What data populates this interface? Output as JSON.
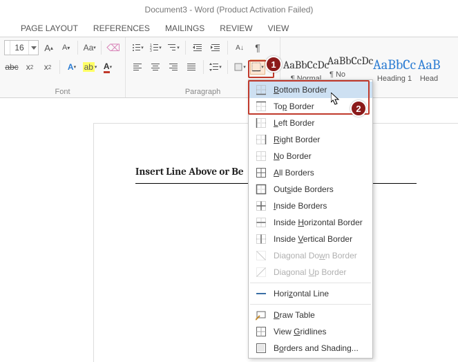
{
  "title": "Document3 - Word (Product Activation Failed)",
  "tabs": [
    "PAGE LAYOUT",
    "REFERENCES",
    "MAILINGS",
    "REVIEW",
    "VIEW"
  ],
  "font": {
    "size": "16",
    "group_label": "Font"
  },
  "paragraph": {
    "group_label": "Paragraph"
  },
  "styles": [
    {
      "preview": "AaBbCcDc",
      "label": "¶ Normal",
      "heading": false
    },
    {
      "preview": "AaBbCcDc",
      "label": "¶ No Spac...",
      "heading": false
    },
    {
      "preview": "AaBbCc",
      "label": "Heading 1",
      "heading": true
    },
    {
      "preview": "AaB",
      "label": "Head",
      "heading": true
    }
  ],
  "document": {
    "line": "Insert Line Above or Be"
  },
  "border_menu": {
    "items": [
      {
        "key": "bottom",
        "label_pre": "",
        "u": "B",
        "label_post": "ottom Border",
        "icon": "border-bottom",
        "disabled": false
      },
      {
        "key": "top",
        "label_pre": "To",
        "u": "p",
        "label_post": " Border",
        "icon": "border-top",
        "disabled": false
      },
      {
        "key": "left",
        "label_pre": "",
        "u": "L",
        "label_post": "eft Border",
        "icon": "border-left",
        "disabled": false
      },
      {
        "key": "right",
        "label_pre": "",
        "u": "R",
        "label_post": "ight Border",
        "icon": "border-right",
        "disabled": false
      },
      {
        "key": "none",
        "label_pre": "",
        "u": "N",
        "label_post": "o Border",
        "icon": "border-none",
        "disabled": false
      },
      {
        "key": "all",
        "label_pre": "",
        "u": "A",
        "label_post": "ll Borders",
        "icon": "border-all",
        "disabled": false
      },
      {
        "key": "outside",
        "label_pre": "Out",
        "u": "s",
        "label_post": "ide Borders",
        "icon": "border-outside",
        "disabled": false
      },
      {
        "key": "inside",
        "label_pre": "",
        "u": "I",
        "label_post": "nside Borders",
        "icon": "border-inside",
        "disabled": false
      },
      {
        "key": "insideh",
        "label_pre": "Inside ",
        "u": "H",
        "label_post": "orizontal Border",
        "icon": "border-inside-h",
        "disabled": false
      },
      {
        "key": "insidev",
        "label_pre": "Inside ",
        "u": "V",
        "label_post": "ertical Border",
        "icon": "border-inside-v",
        "disabled": false
      },
      {
        "key": "diagdown",
        "label_pre": "Diagonal Do",
        "u": "w",
        "label_post": "n Border",
        "icon": "border-diag-down",
        "disabled": true
      },
      {
        "key": "diagup",
        "label_pre": "Diagonal ",
        "u": "U",
        "label_post": "p Border",
        "icon": "border-diag-up",
        "disabled": true
      },
      {
        "sep": true
      },
      {
        "key": "hline",
        "label_pre": "Hori",
        "u": "z",
        "label_post": "ontal Line",
        "icon": "horizontal-line",
        "disabled": false
      },
      {
        "sep": true
      },
      {
        "key": "draw",
        "label_pre": "",
        "u": "D",
        "label_post": "raw Table",
        "icon": "draw-table",
        "disabled": false
      },
      {
        "key": "gridlines",
        "label_pre": "View ",
        "u": "G",
        "label_post": "ridlines",
        "icon": "gridlines",
        "disabled": false
      },
      {
        "key": "shading",
        "label_pre": "B",
        "u": "o",
        "label_post": "rders and Shading...",
        "icon": "borders-shading",
        "disabled": false
      }
    ]
  },
  "callouts": {
    "c1": "1",
    "c2": "2"
  }
}
